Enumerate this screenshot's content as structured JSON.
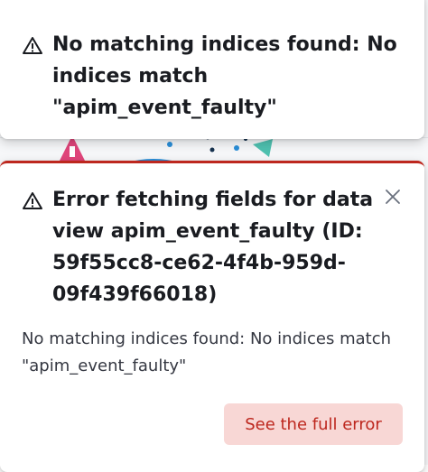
{
  "toasts": [
    {
      "title": "No matching indices found: No indices match \"apim_event_faulty\"",
      "icon": "warning-icon"
    },
    {
      "title": "Error fetching fields for data view apim_event_faulty (ID: 59f55cc8-ce62-4f4b-959d-09f439f66018)",
      "body": "No matching indices found: No indices match \"apim_event_faulty\"",
      "button_label": "See the full error",
      "icon": "warning-icon",
      "close_icon": "close-icon"
    }
  ],
  "colors": {
    "danger": "#bd271e",
    "danger_light": "#f8d7d5",
    "title_text": "#1a1c21",
    "body_text": "#343741"
  }
}
